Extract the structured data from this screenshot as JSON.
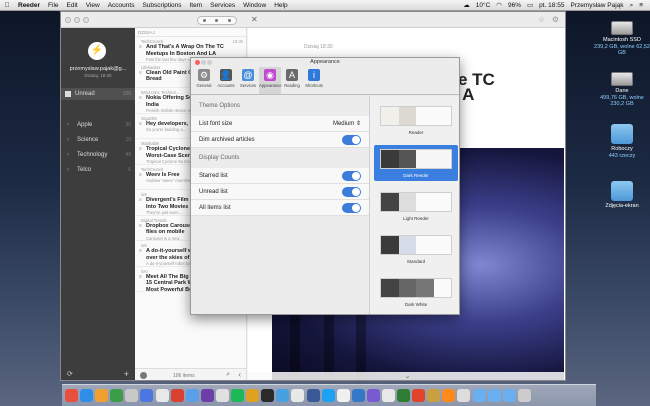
{
  "menubar": {
    "apple": "",
    "items": [
      "Reeder",
      "File",
      "Edit",
      "View",
      "Accounts",
      "Subscriptions",
      "Item",
      "Services",
      "Window",
      "Help"
    ],
    "status": {
      "temp": "10°C",
      "battery": "96%",
      "clock": "pt. 18:55",
      "user": "Przemysław Pająk"
    }
  },
  "desktop": [
    {
      "name": "Macintosh SSD",
      "detail": "239,2 GB, wolne 62,52 GB",
      "kind": "hdd"
    },
    {
      "name": "Dane",
      "detail": "499,76 GB, wolne 230,2 GB",
      "kind": "hdd"
    },
    {
      "name": "Roboczy",
      "detail": "443 rzeczy",
      "kind": "folder"
    },
    {
      "name": "Zdjęcia-ekran",
      "detail": "",
      "kind": "folder"
    }
  ],
  "sidebar": {
    "logo": "⚡",
    "account": "przemyslaw.pajak@g...",
    "account_sub": "Dzisiaj, 18:30",
    "unread_label": "Unread",
    "unread_count": "106",
    "folders": [
      {
        "label": "Apple",
        "count": "30"
      },
      {
        "label": "Science",
        "count": "10"
      },
      {
        "label": "Technology",
        "count": "49"
      },
      {
        "label": "Telco",
        "count": "6"
      }
    ],
    "refresh_icon": "⟳",
    "add_icon": "+"
  },
  "list": {
    "header": "DZISIAJ",
    "articles": [
      {
        "source": "TechCrunch",
        "time": "18:30",
        "title": "And That's A Wrap On The TC Meetups In Boston And LA",
        "snippet": "Fast the last few days weve been in..."
      },
      {
        "source": "Lifehacker",
        "time": "",
        "title": "Clean Old Paint Off Hinges with Bread",
        "snippet": ""
      },
      {
        "source": "WSJ.com: Technol...",
        "time": "",
        "title": "Nokia Offering Surprise Rally In India",
        "snippet": "Finnish mobile-device maker Nokia..."
      },
      {
        "source": "GigaOM",
        "time": "",
        "title": "Hey developers, we have a challenge",
        "snippet": "So you're building a..."
      },
      {
        "source": "Mashable",
        "time": "",
        "title": "Tropical Cyclone Hits Australia, But Worst-Case Scenario Averted",
        "snippet": "Tropical Cyclone Ita made..."
      },
      {
        "source": "TechCrunch",
        "time": "",
        "title": "Weev Is Free",
        "snippet": "Andrew \"weev\" Auernheimer..."
      },
      {
        "source": "io9",
        "time": "",
        "title": "Divergent's Film Sequel Will Be Split Into Two Movies",
        "snippet": "They've just seen..."
      },
      {
        "source": "Digital Trends",
        "time": "",
        "title": "Dropbox Carousel uploads media files on mobile",
        "snippet": "Carousel is a new..."
      },
      {
        "source": "io9",
        "time": "",
        "title": "A do-it-yourself war has been waged over the skies of Syria.",
        "snippet": "A do-it-yourself robot battle is being waged..."
      },
      {
        "source": "SAI",
        "time": "18:38",
        "title": "Meet All The Big Shots Who Live In 15 Central Park West, The World's Most Powerful Building",
        "snippet": ""
      }
    ],
    "footer_count": "106 items",
    "search_icon": "⌕",
    "back_icon": "‹"
  },
  "content": {
    "date": "Dzisiaj 18:30",
    "title_fragment": "e TC\n A",
    "scroll_hint": "⌄"
  },
  "prefs": {
    "title": "Appearance",
    "toolbar": [
      {
        "label": "General",
        "icon": "⚙",
        "color": "#8a8a8a"
      },
      {
        "label": "Accounts",
        "icon": "👤",
        "color": "#555555"
      },
      {
        "label": "Services",
        "icon": "@",
        "color": "#4a90d9"
      },
      {
        "label": "Appearance",
        "icon": "◉",
        "color": "#c04ad0"
      },
      {
        "label": "Reading",
        "icon": "A",
        "color": "#6a6a6a"
      },
      {
        "label": "Shortcuts",
        "icon": "i",
        "color": "#2f7ad8"
      }
    ],
    "theme_options_header": "Theme Options",
    "list_font_size_label": "List font size",
    "list_font_size_value": "Medium",
    "dim_archived_label": "Dim archived articles",
    "display_counts_header": "Display Counts",
    "starred_list_label": "Starred list",
    "unread_list_label": "Unread list",
    "all_items_list_label": "All items list",
    "themes": [
      {
        "name": "Reader",
        "colors": [
          "#f2f0ea",
          "#dcdad2",
          "#fbfbfb",
          "#fbfbfb"
        ],
        "selected": false
      },
      {
        "name": "Dark Reeder",
        "colors": [
          "#3a3a3a",
          "#555555",
          "#f7f7f7",
          "#f7f7f7"
        ],
        "selected": true
      },
      {
        "name": "Light Reeder",
        "colors": [
          "#444444",
          "#dddddd",
          "#fbfbfb",
          "#fbfbfb"
        ],
        "selected": false
      },
      {
        "name": "Standard",
        "colors": [
          "#3b3b3b",
          "#d7dde8",
          "#fafafa",
          "#fafafa"
        ],
        "selected": false
      },
      {
        "name": "Dark White",
        "colors": [
          "#444444",
          "#666666",
          "#777777",
          "#fafafa"
        ],
        "selected": false
      }
    ]
  },
  "dock": {
    "colors": [
      "#e94f3d",
      "#2f8fe8",
      "#f0a030",
      "#3c9c48",
      "#c8c8c8",
      "#4a78e0",
      "#e8e8e8",
      "#d84030",
      "#5aa0e8",
      "#6c3fa8",
      "#e0e0e0",
      "#1db954",
      "#e0a020",
      "#2a2a2a",
      "#48a0e0",
      "#e8e8e8",
      "#3a5898",
      "#1da1f2",
      "#f0f0f0",
      "#3478c8",
      "#7a5ad0",
      "#e8e8e8",
      "#2e7d32",
      "#e0452c",
      "#c8a040",
      "#ff8a1a",
      "#dddddd",
      "#6ab0f0",
      "#6ab0f0",
      "#6ab0f0",
      "#cccccc"
    ]
  }
}
